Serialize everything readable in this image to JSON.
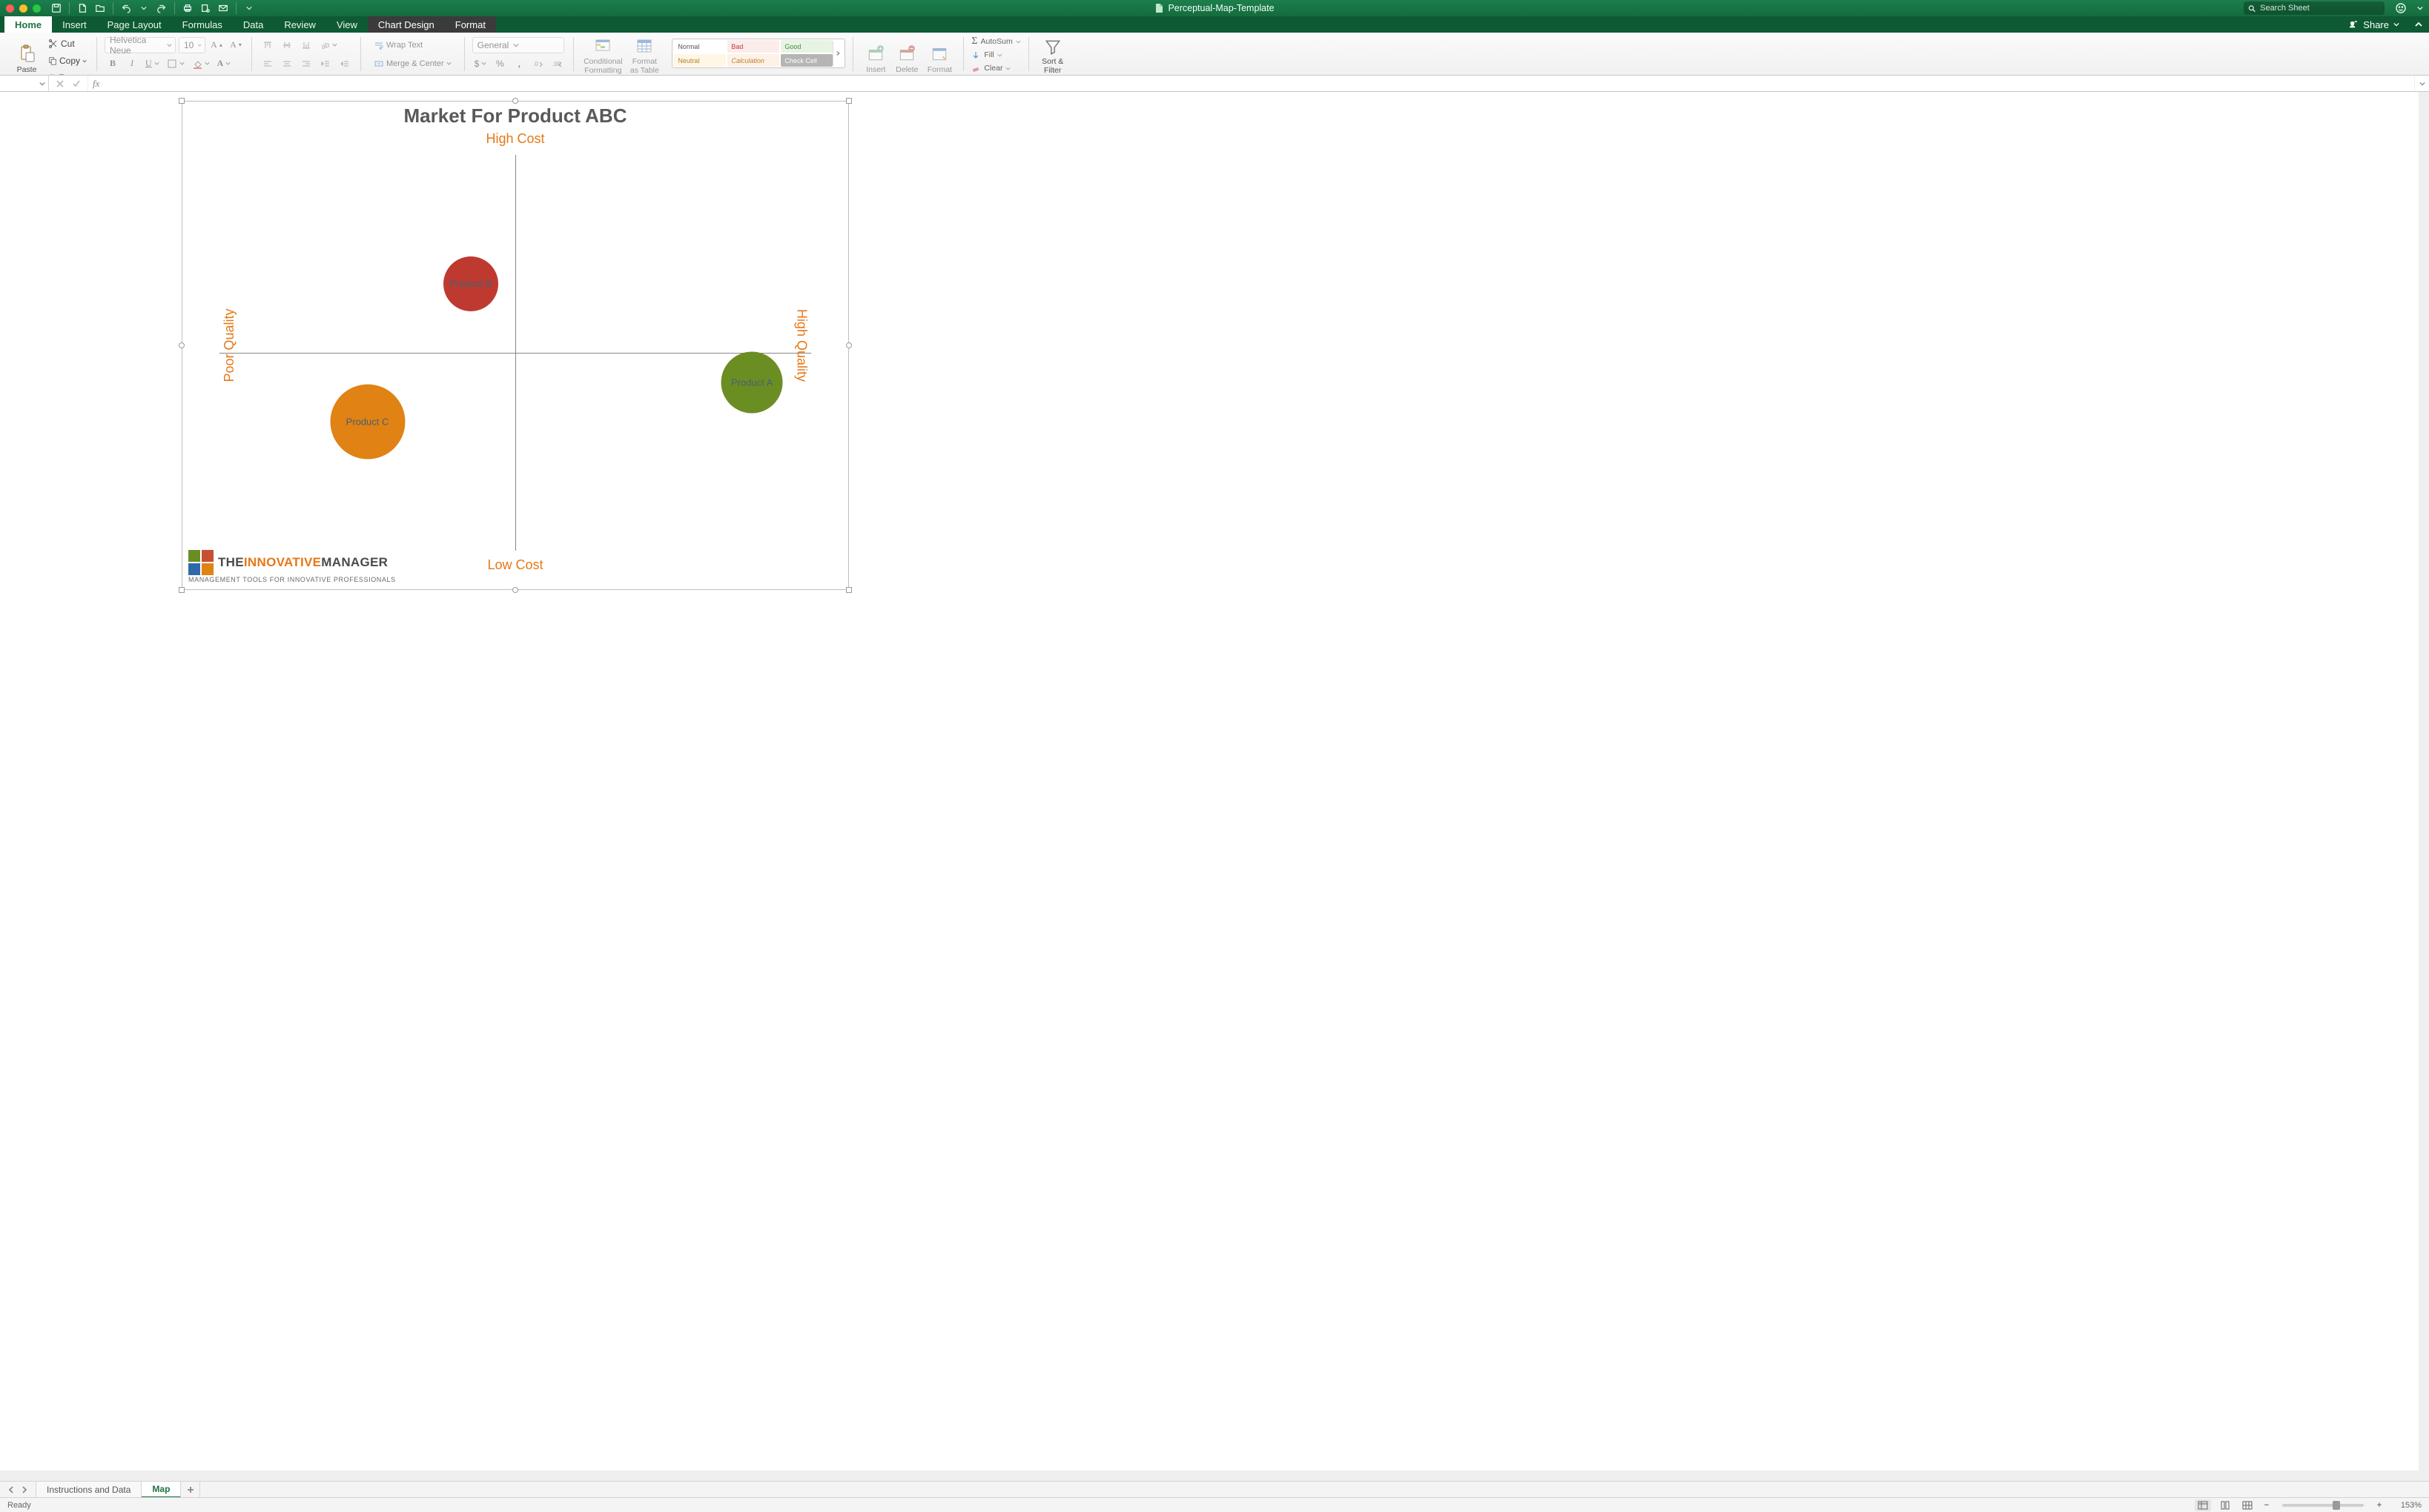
{
  "window": {
    "title": "Perceptual-Map-Template",
    "search_placeholder": "Search Sheet"
  },
  "tabs": {
    "home": "Home",
    "insert": "Insert",
    "page_layout": "Page Layout",
    "formulas": "Formulas",
    "data": "Data",
    "review": "Review",
    "view": "View",
    "chart_design": "Chart Design",
    "format": "Format",
    "share": "Share"
  },
  "ribbon": {
    "paste": "Paste",
    "cut": "Cut",
    "copy": "Copy",
    "format_painter": "Format",
    "font_name": "Helvetica Neue",
    "font_size": "10",
    "wrap_text": "Wrap Text",
    "merge_center": "Merge & Center",
    "number_format": "General",
    "cond_fmt1": "Conditional",
    "cond_fmt2": "Formatting",
    "fmt_table1": "Format",
    "fmt_table2": "as Table",
    "insert": "Insert",
    "delete": "Delete",
    "format_cells": "Format",
    "autosum": "AutoSum",
    "fill": "Fill",
    "clear": "Clear",
    "sort1": "Sort &",
    "sort2": "Filter",
    "styles": {
      "normal": "Normal",
      "bad": "Bad",
      "good": "Good",
      "neutral": "Neutral",
      "calculation": "Calculation",
      "check_cell": "Check Cell"
    }
  },
  "formula_bar": {
    "fx": "fx",
    "value": ""
  },
  "sheet_tabs": {
    "tab1": "Instructions and Data",
    "tab2": "Map"
  },
  "status": {
    "ready": "Ready",
    "zoom": "153%"
  },
  "chart": {
    "title": "Market For Product ABC",
    "axis_top": "High Cost",
    "axis_bottom": "Low Cost",
    "axis_left": "Poor Quality",
    "axis_right": "High Quality",
    "logo_text_pre": "THE",
    "logo_text_mid": "INNOVATIVE",
    "logo_text_post": "MANAGER",
    "logo_sub": "MANAGEMENT TOOLS FOR INNOVATIVE PROFESSIONALS"
  },
  "chart_data": {
    "type": "scatter",
    "title": "Market For Product ABC",
    "xlabel_low": "Poor Quality",
    "xlabel_high": "High Quality",
    "ylabel_low": "Low Cost",
    "ylabel_high": "High Cost",
    "xlim": [
      -10,
      10
    ],
    "ylim": [
      -10,
      10
    ],
    "series": [
      {
        "name": "Product A",
        "x": 8.0,
        "y": -1.5,
        "size": 35,
        "color": "#6b8e23"
      },
      {
        "name": "Product B",
        "x": -1.5,
        "y": 3.5,
        "size": 30,
        "color": "#be3a31"
      },
      {
        "name": "Product C",
        "x": -5.0,
        "y": -3.5,
        "size": 45,
        "color": "#e08214"
      }
    ]
  }
}
